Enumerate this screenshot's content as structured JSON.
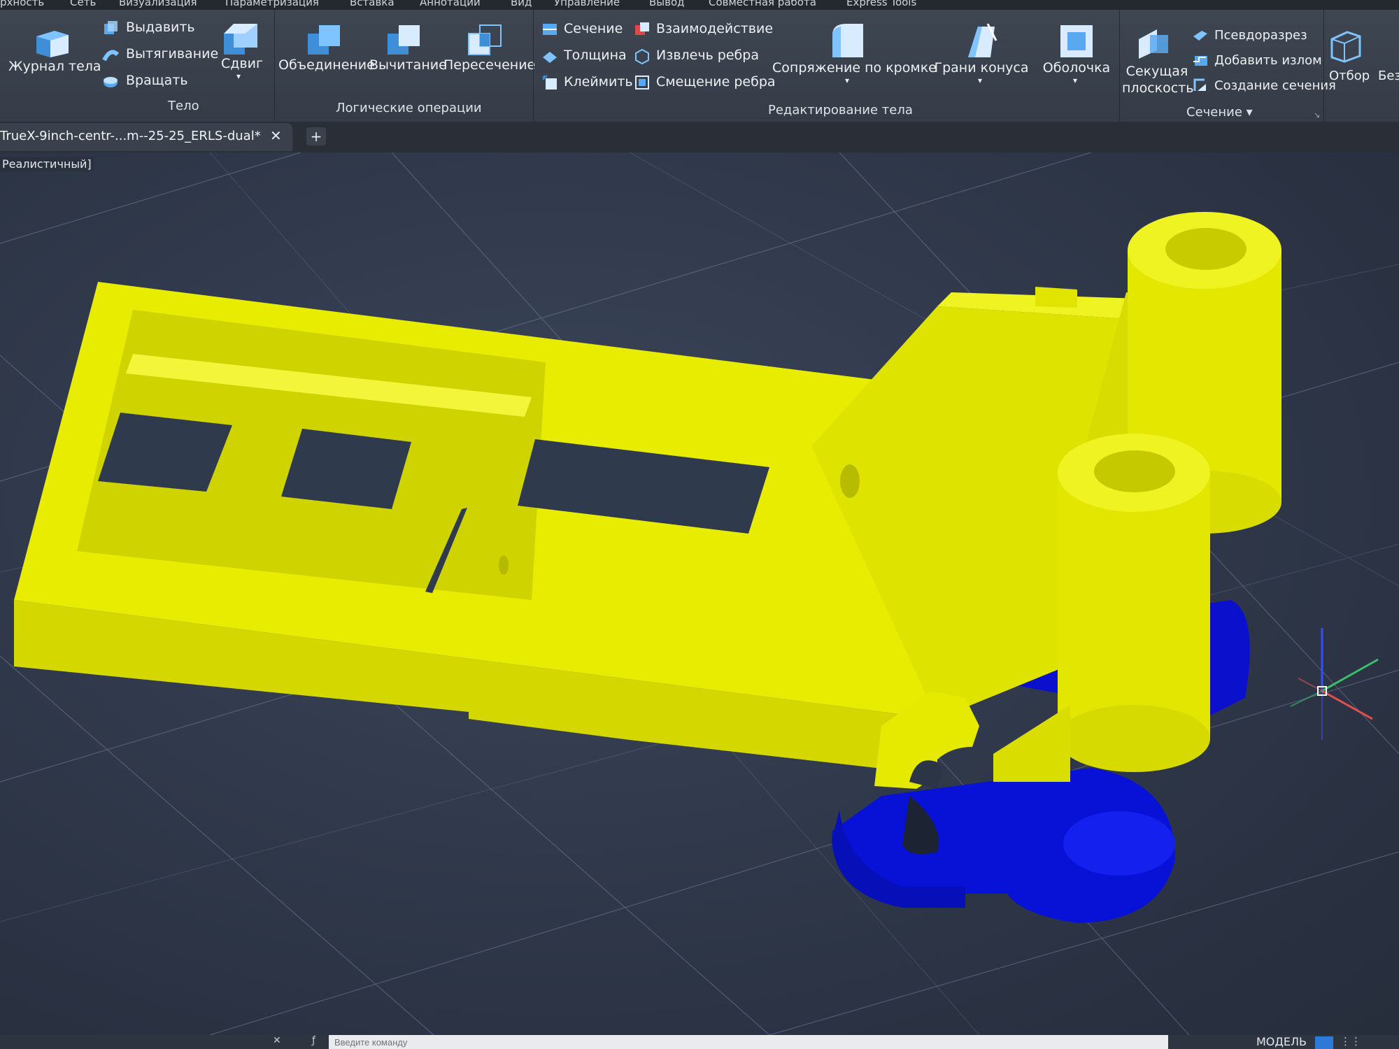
{
  "menu": [
    "рхность",
    "Сеть",
    "Визуализация",
    "Параметризация",
    "Вставка",
    "Аннотации",
    "Вид",
    "Управление",
    "Вывод",
    "Совместная работа",
    "Express Tools"
  ],
  "ribbon": {
    "body_panel": {
      "title": "Тело",
      "journal": "Журнал тела",
      "extrude": "Выдавить",
      "stretch": "Вытягивание",
      "rotate": "Вращать",
      "shift": "Сдвиг"
    },
    "boolean_panel": {
      "title": "Логические операции",
      "union": "Объединение",
      "subtract": "Вычитание",
      "intersect": "Пересечение"
    },
    "edit_panel": {
      "title": "Редактирование тела",
      "section": "Сечение",
      "thickness": "Толщина",
      "imprint": "Клеймить",
      "interference": "Взаимодействие",
      "extract_edges": "Извлечь ребра",
      "offset_edges": "Смещение ребра",
      "fillet": "Сопряжение по кромке",
      "taper": "Грани конуса",
      "shell": "Оболочка"
    },
    "section_panel": {
      "title": "Сечение",
      "plane": "Секущая плоскость",
      "plane_line1": "Секущая",
      "plane_line2": "плоскость",
      "pseudo": "Псевдоразрез",
      "add_jog": "Добавить излом",
      "create_section": "Создание сечения"
    },
    "extra": {
      "selection": "Отбор",
      "no_filter": "Без"
    }
  },
  "tabs": {
    "document": "TrueX-9inch-centr-...m--25-25_ERLS-dual*",
    "close": "✕",
    "new": "+"
  },
  "viewport": {
    "visual_style": "Реалистичный"
  },
  "command": {
    "placeholder": "Введите команду",
    "model": "МОДЕЛЬ"
  },
  "colors": {
    "part_yellow": "#e6ea00",
    "part_blue": "#0a14ee",
    "ribbon_bg": "#3a414c"
  }
}
